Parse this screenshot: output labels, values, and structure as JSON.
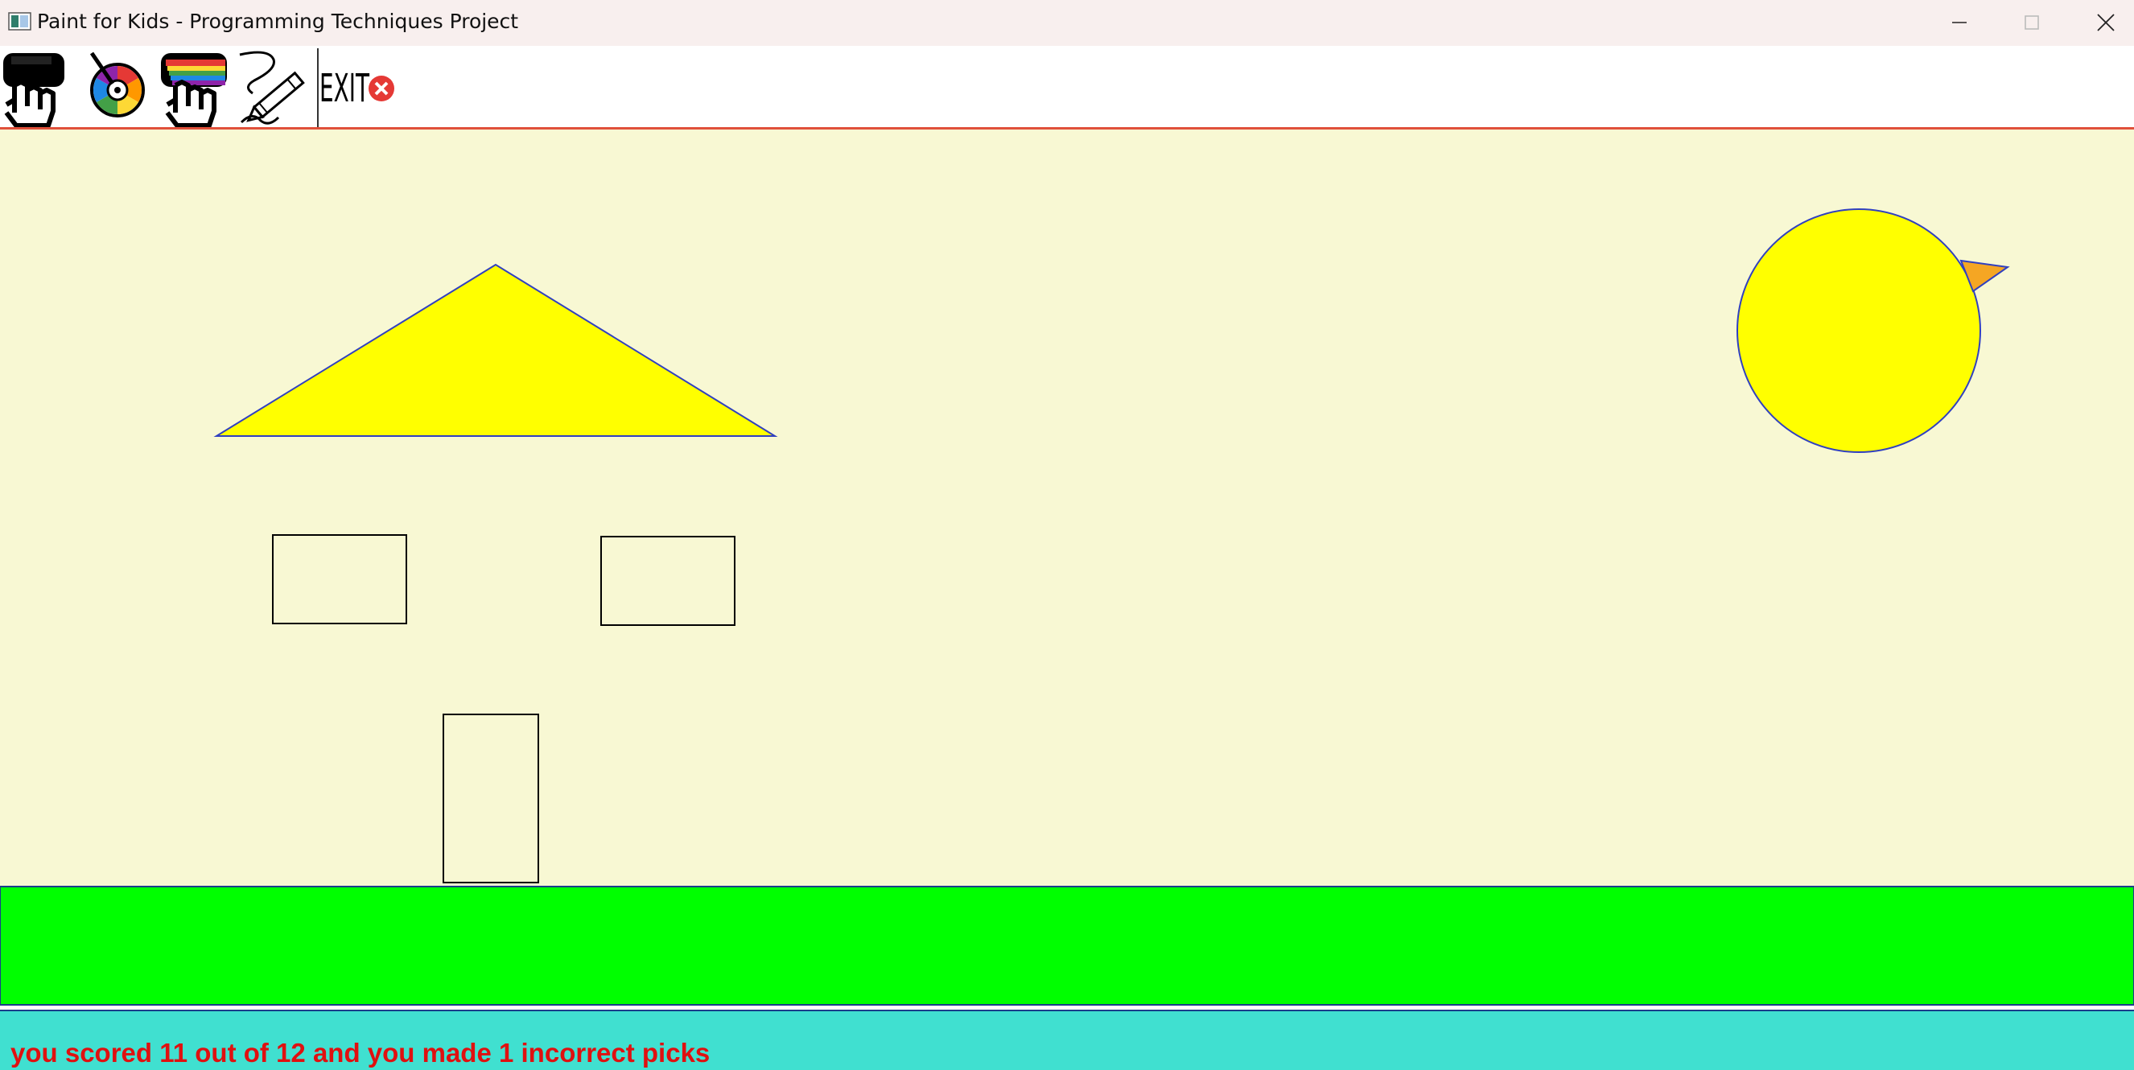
{
  "window": {
    "title": "Paint for Kids - Programming Techniques Project",
    "controls": [
      "minimize-icon",
      "maximize-icon",
      "close-icon"
    ]
  },
  "toolbar": {
    "items": [
      {
        "name": "pick-by-shape-tool",
        "icon": "pointing-hand-shapes-icon"
      },
      {
        "name": "pick-by-color-tool",
        "icon": "color-wheel-icon"
      },
      {
        "name": "pick-by-both-tool",
        "icon": "pointing-hand-rainbow-icon"
      },
      {
        "name": "draw-mode-tool",
        "icon": "pencil-icon"
      },
      {
        "name": "exit-tool",
        "icon": "exit-icon",
        "label": "EXIT"
      }
    ],
    "separator_color": "#e0503a"
  },
  "canvas": {
    "background": "#f8f8d3",
    "shapes": [
      {
        "type": "triangle",
        "name": "roof",
        "fill": "#ffff00",
        "stroke": "#3040c0"
      },
      {
        "type": "rectangle",
        "name": "left-window",
        "fill": "none",
        "stroke": "#000000"
      },
      {
        "type": "rectangle",
        "name": "right-window",
        "fill": "none",
        "stroke": "#000000"
      },
      {
        "type": "rectangle",
        "name": "door",
        "fill": "none",
        "stroke": "#000000"
      },
      {
        "type": "circle",
        "name": "sun",
        "fill": "#ffff00",
        "stroke": "#3040c0"
      },
      {
        "type": "triangle",
        "name": "sun-ray",
        "fill": "#f5a623",
        "stroke": "#3040c0"
      },
      {
        "type": "rectangle",
        "name": "grass",
        "fill": "#00ff00",
        "stroke": "#1a3d8a"
      }
    ]
  },
  "status": {
    "message": "you scored 11 out of 12 and you made 1 incorrect picks",
    "background": "#40e0d0",
    "text_color": "#e01010"
  }
}
